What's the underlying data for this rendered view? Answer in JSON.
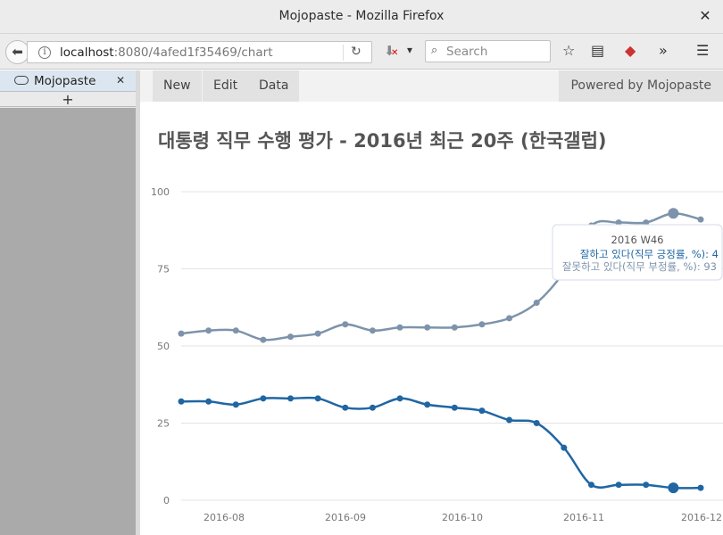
{
  "window": {
    "title": "Mojopaste - Mozilla Firefox"
  },
  "browser": {
    "url_host": "localhost",
    "url_rest": ":8080/4afed1f35469/chart",
    "search_placeholder": "Search"
  },
  "sidebar": {
    "tab_label": "Mojopaste",
    "new_tab": "+"
  },
  "app_nav": {
    "new": "New",
    "edit": "Edit",
    "data": "Data",
    "powered": "Powered by Mojopaste"
  },
  "chart_data": {
    "type": "line",
    "title": "대통령 직무 수행 평가 - 2016년 최근 20주 (한국갤럽)",
    "ylim": [
      0,
      100
    ],
    "yticks": [
      0,
      25,
      50,
      75,
      100
    ],
    "xtick_labels": [
      "2016-08",
      "2016-09",
      "2016-10",
      "2016-11",
      "2016-12"
    ],
    "x": [
      "2016 W28",
      "2016 W29",
      "2016 W30",
      "2016 W31",
      "2016 W32",
      "2016 W33",
      "2016 W34",
      "2016 W35",
      "2016 W36",
      "2016 W37",
      "2016 W38",
      "2016 W39",
      "2016 W40",
      "2016 W41",
      "2016 W42",
      "2016 W43",
      "2016 W44",
      "2016 W45",
      "2016 W46",
      "2016 W47"
    ],
    "series": [
      {
        "name": "잘하고 있다(직무 긍정률, %)",
        "color": "#1f66a3",
        "values": [
          32,
          32,
          31,
          33,
          33,
          33,
          30,
          30,
          33,
          31,
          30,
          29,
          26,
          25,
          17,
          5,
          5,
          5,
          4,
          4
        ]
      },
      {
        "name": "잘못하고 있다(직무 부정률, %)",
        "color": "#7d93ab",
        "values": [
          54,
          55,
          55,
          52,
          53,
          54,
          57,
          55,
          56,
          56,
          56,
          57,
          59,
          64,
          74,
          89,
          90,
          90,
          93,
          91
        ]
      }
    ],
    "grid": true,
    "tooltip": {
      "header": "2016 W46",
      "line1": "잘하고 있다(직무 긍정률, %): 4",
      "line2": "잘못하고 있다(직무 부정률, %): 93"
    }
  }
}
